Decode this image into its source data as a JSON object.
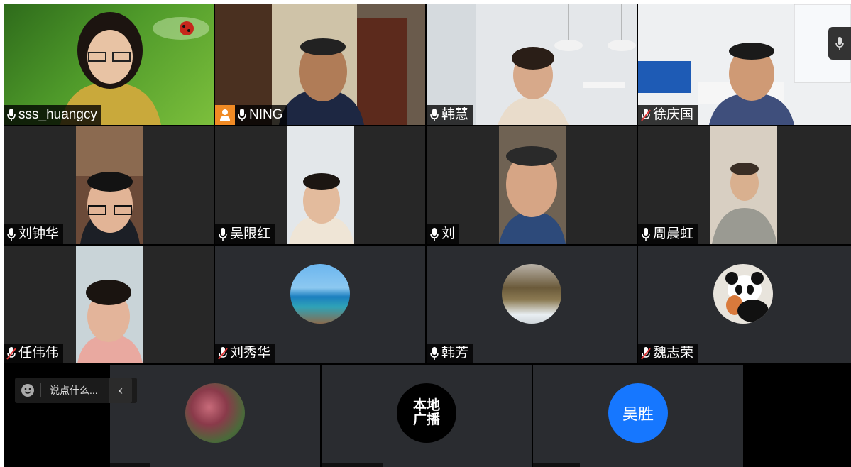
{
  "participants": [
    {
      "name": "sss_huangcy",
      "mic": "on"
    },
    {
      "name": "NING",
      "mic": "on",
      "host": true
    },
    {
      "name": "韩慧",
      "mic": "on"
    },
    {
      "name": "徐庆国",
      "mic": "muted"
    },
    {
      "name": "刘钟华",
      "mic": "on"
    },
    {
      "name": "吴限红",
      "mic": "on"
    },
    {
      "name": "刘",
      "mic": "on"
    },
    {
      "name": "周晨虹",
      "mic": "on"
    },
    {
      "name": "任伟伟",
      "mic": "muted"
    },
    {
      "name": "刘秀华",
      "mic": "muted"
    },
    {
      "name": "韩芳",
      "mic": "on"
    },
    {
      "name": "魏志荣",
      "mic": "muted"
    }
  ],
  "bottom_row": {
    "broadcast_avatar_text": "本地\n广播",
    "initial_avatar_text": "吴胜",
    "initial_avatar_color": "#1677ff"
  },
  "chat": {
    "placeholder": "说点什么...",
    "collapse_glyph": "‹"
  },
  "colors": {
    "muted_mic": "#e23b3b",
    "host_badge": "#f08a24"
  }
}
